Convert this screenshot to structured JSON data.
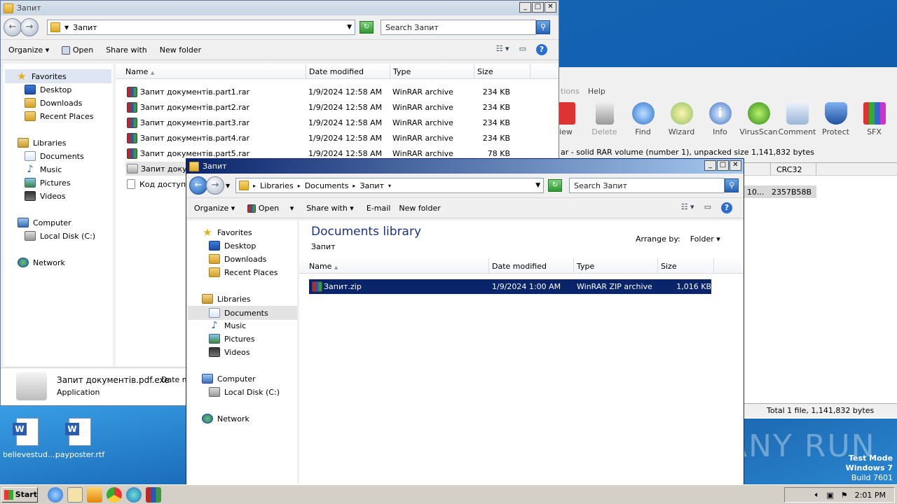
{
  "desktop": {
    "icons": [
      {
        "label": "believestud..."
      },
      {
        "label": "payposter.rtf"
      }
    ],
    "watermark": "ANY RUN",
    "test_mode": [
      "Test Mode",
      "Windows 7",
      "Build 7601"
    ]
  },
  "rar_window": {
    "menu_partial": [
      "tions",
      "Help"
    ],
    "tools": [
      {
        "label": "iew",
        "icon": "view-icon"
      },
      {
        "label": "Delete",
        "icon": "delete-icon"
      },
      {
        "label": "Find",
        "icon": "find-icon"
      },
      {
        "label": "Wizard",
        "icon": "wizard-icon"
      },
      {
        "label": "Info",
        "icon": "info-icon"
      },
      {
        "label": "VirusScan",
        "icon": "virusscan-icon"
      },
      {
        "label": "Comment",
        "icon": "comment-icon"
      },
      {
        "label": "Protect",
        "icon": "protect-icon"
      },
      {
        "label": "SFX",
        "icon": "sfx-icon"
      }
    ],
    "info_line": "ar - solid RAR volume (number 1), unpacked size 1,141,832 bytes",
    "col_crc": "CRC32",
    "row_partial": "10...",
    "row_crc": "2357B58B",
    "status": "Total 1 file, 1,141,832 bytes"
  },
  "win1": {
    "title": "Запит",
    "address": "Запит",
    "search_placeholder": "Search Запит",
    "toolbar": {
      "organize": "Organize",
      "open": "Open",
      "share": "Share with",
      "newfolder": "New folder"
    },
    "nav": {
      "favorites": "Favorites",
      "desktop": "Desktop",
      "downloads": "Downloads",
      "recent": "Recent Places",
      "libraries": "Libraries",
      "documents": "Documents",
      "music": "Music",
      "pictures": "Pictures",
      "videos": "Videos",
      "computer": "Computer",
      "localdisk": "Local Disk (C:)",
      "network": "Network"
    },
    "columns": {
      "name": "Name",
      "date": "Date modified",
      "type": "Type",
      "size": "Size"
    },
    "files": [
      {
        "name": "Запит документів.part1.rar",
        "date": "1/9/2024 12:58 AM",
        "type": "WinRAR archive",
        "size": "234 KB"
      },
      {
        "name": "Запит документів.part2.rar",
        "date": "1/9/2024 12:58 AM",
        "type": "WinRAR archive",
        "size": "234 KB"
      },
      {
        "name": "Запит документів.part3.rar",
        "date": "1/9/2024 12:58 AM",
        "type": "WinRAR archive",
        "size": "234 KB"
      },
      {
        "name": "Запит документів.part4.rar",
        "date": "1/9/2024 12:58 AM",
        "type": "WinRAR archive",
        "size": "234 KB"
      },
      {
        "name": "Запит документів.part5.rar",
        "date": "1/9/2024 12:58 AM",
        "type": "WinRAR archive",
        "size": "78 KB"
      },
      {
        "name": "Запит докум",
        "date": "",
        "type": "",
        "size": ""
      },
      {
        "name": "Код доступу",
        "date": "",
        "type": "",
        "size": ""
      }
    ],
    "details": {
      "name": "Запит документів.pdf.exe",
      "date_label": "Date m",
      "type": "Application"
    }
  },
  "win2": {
    "title": "Запит",
    "breadcrumb": [
      "Libraries",
      "Documents",
      "Запит"
    ],
    "search_placeholder": "Search Запит",
    "toolbar": {
      "organize": "Organize",
      "open": "Open",
      "share": "Share with",
      "email": "E-mail",
      "newfolder": "New folder"
    },
    "nav": {
      "favorites": "Favorites",
      "desktop": "Desktop",
      "downloads": "Downloads",
      "recent": "Recent Places",
      "libraries": "Libraries",
      "documents": "Documents",
      "music": "Music",
      "pictures": "Pictures",
      "videos": "Videos",
      "computer": "Computer",
      "localdisk": "Local Disk (C:)",
      "network": "Network"
    },
    "library_title": "Documents library",
    "library_sub": "Запит",
    "arrange_label": "Arrange by:",
    "arrange_value": "Folder",
    "columns": {
      "name": "Name",
      "date": "Date modified",
      "type": "Type",
      "size": "Size"
    },
    "files": [
      {
        "name": "Запит.zip",
        "date": "1/9/2024 1:00 AM",
        "type": "WinRAR ZIP archive",
        "size": "1,016 KB"
      }
    ]
  },
  "taskbar": {
    "start": "Start",
    "time": "2:01 PM"
  }
}
